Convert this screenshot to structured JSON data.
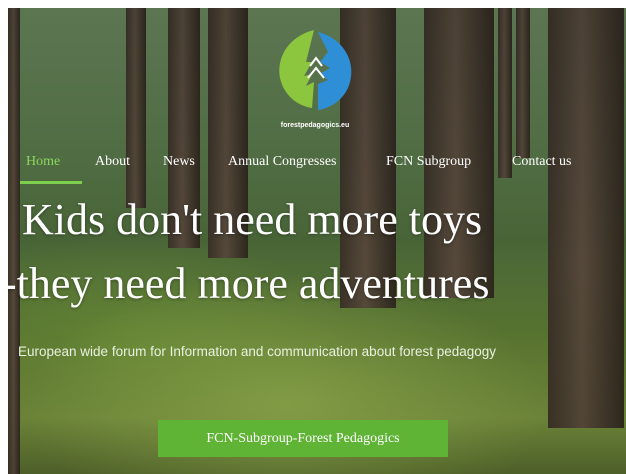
{
  "brand": {
    "logo_caption": "forestpedagogics.eu"
  },
  "nav": {
    "items": [
      {
        "label": "Home",
        "active": true
      },
      {
        "label": "About"
      },
      {
        "label": "News"
      },
      {
        "label": "Annual Congresses"
      },
      {
        "label": "FCN Subgroup"
      },
      {
        "label": "Contact us"
      }
    ]
  },
  "hero": {
    "headline_line1": "Kids don't need more toys",
    "headline_line2": "-they need more adventures",
    "subheadline": "European wide forum for Information and communication about forest pedagogy",
    "cta_label": "FCN-Subgroup-Forest Pedagogics"
  },
  "colors": {
    "accent": "#5fb335",
    "nav_active": "#8cd65c",
    "logo_green": "#8cc63f",
    "logo_blue": "#2f8fd6"
  }
}
